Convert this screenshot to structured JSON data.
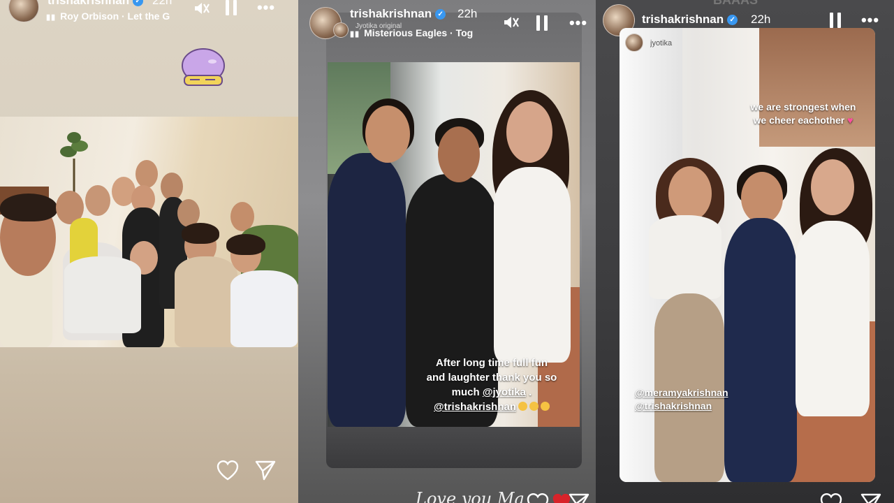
{
  "story1": {
    "username": "trishakrishnan",
    "time": "22h",
    "music": "Roy Orbison · Let the G",
    "sticker_icon": "purple-blob-sticker-icon"
  },
  "story2": {
    "username": "trishakrishnan",
    "time": "22h",
    "subtitle": "Jyotika original",
    "music": "Misterious Eagles · Tog",
    "caption_lines": [
      "After long time full fun",
      "and laughter thank you so",
      "much"
    ],
    "caption_mention1": "@jyotika",
    "caption_mention1_suffix": " .",
    "caption_mention2": "@trishakrishnan",
    "reply_text": "Love you Ma"
  },
  "story3": {
    "username": "trishakrishnan",
    "time": "22h",
    "top_banner": "BAAAS",
    "reshare_username": "jyotika",
    "caption_line1": "we are strongest when",
    "caption_line2": "we cheer eachother",
    "mention1": "@meramyakrishnan",
    "mention2": "@trishakrishnan"
  },
  "colors": {
    "verified_badge": "#3897f0",
    "heart_emoji": "#ff4fa0",
    "story1_bg": "#d8cfbf",
    "story2_frame": "#8e8e90",
    "story3_bg": "#3c3c3e"
  },
  "icons": [
    "mute-icon",
    "pause-icon",
    "more-icon",
    "heart-icon",
    "send-icon",
    "verified-icon"
  ]
}
